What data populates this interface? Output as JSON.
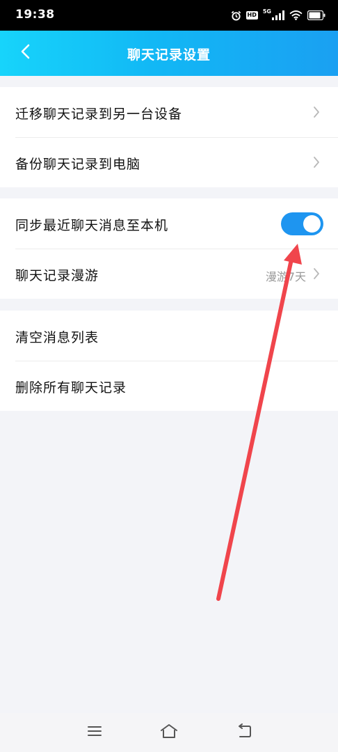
{
  "status_bar": {
    "time": "19:38",
    "hd_badge": "HD",
    "network": "5G",
    "icons": [
      "alarm-icon",
      "hd-icon",
      "signal-icon",
      "wifi-icon",
      "battery-icon"
    ]
  },
  "header": {
    "title": "聊天记录设置",
    "back_icon": "chevron-left-icon"
  },
  "groups": [
    {
      "items": [
        {
          "label": "迁移聊天记录到另一台设备"
        },
        {
          "label": "备份聊天记录到电脑"
        }
      ]
    },
    {
      "items": [
        {
          "label": "同步最近聊天消息至本机",
          "toggle_on": true
        },
        {
          "label": "聊天记录漫游",
          "value": "漫游7天"
        }
      ]
    },
    {
      "items": [
        {
          "label": "清空消息列表"
        },
        {
          "label": "删除所有聊天记录"
        }
      ]
    }
  ],
  "nav_bar": {
    "icons": [
      "menu-icon",
      "home-icon",
      "back-icon"
    ]
  },
  "colors": {
    "header_gradient_start": "#17d4fb",
    "header_gradient_end": "#1aa0f2",
    "toggle_on": "#1e95f0",
    "annotation_arrow": "#f0454c",
    "background": "#f3f4f8"
  }
}
